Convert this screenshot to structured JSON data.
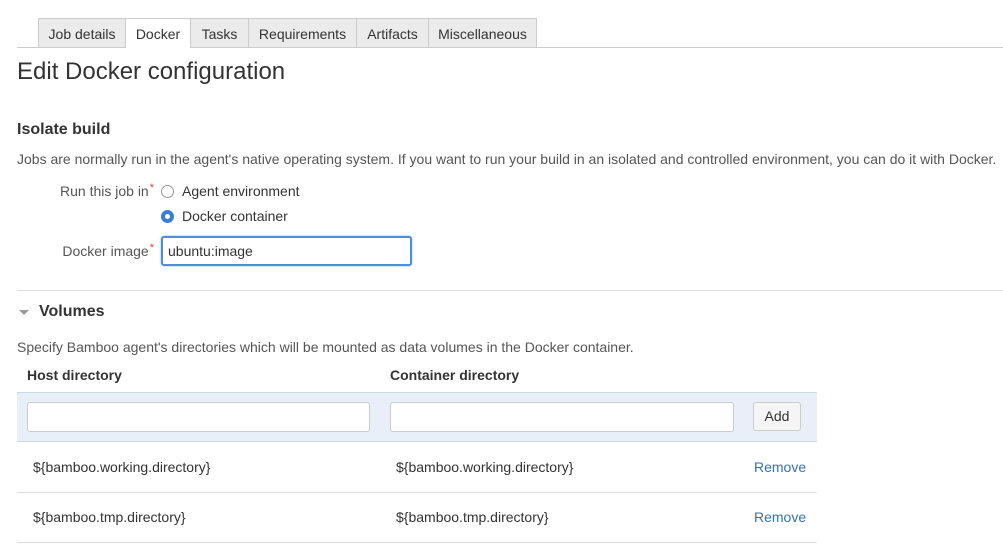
{
  "tabs": [
    {
      "label": "Job details",
      "active": false
    },
    {
      "label": "Docker",
      "active": true
    },
    {
      "label": "Tasks",
      "active": false
    },
    {
      "label": "Requirements",
      "active": false
    },
    {
      "label": "Artifacts",
      "active": false
    },
    {
      "label": "Miscellaneous",
      "active": false
    }
  ],
  "page_title": "Edit Docker configuration",
  "isolate": {
    "title": "Isolate build",
    "description": "Jobs are normally run in the agent's native operating system. If you want to run your build in an isolated and controlled environment, you can do it with Docker.",
    "run_in_label": "Run this job in",
    "required_mark": "*",
    "options": [
      {
        "label": "Agent environment",
        "selected": false
      },
      {
        "label": "Docker container",
        "selected": true
      }
    ],
    "image_label": "Docker image",
    "image_value": "ubuntu:image"
  },
  "volumes": {
    "title": "Volumes",
    "description": "Specify Bamboo agent's directories which will be mounted as data volumes in the Docker container.",
    "columns": [
      "Host directory",
      "Container directory"
    ],
    "host_value": "",
    "container_value": "",
    "add_label": "Add",
    "rows": [
      {
        "host": "${bamboo.working.directory}",
        "container": "${bamboo.working.directory}",
        "action": "Remove"
      },
      {
        "host": "${bamboo.tmp.directory}",
        "container": "${bamboo.tmp.directory}",
        "action": "Remove"
      }
    ]
  },
  "colors": {
    "accent": "#3b7fd4",
    "link": "#3572b0",
    "required": "#d04437",
    "table_highlight": "#e9eff8"
  }
}
